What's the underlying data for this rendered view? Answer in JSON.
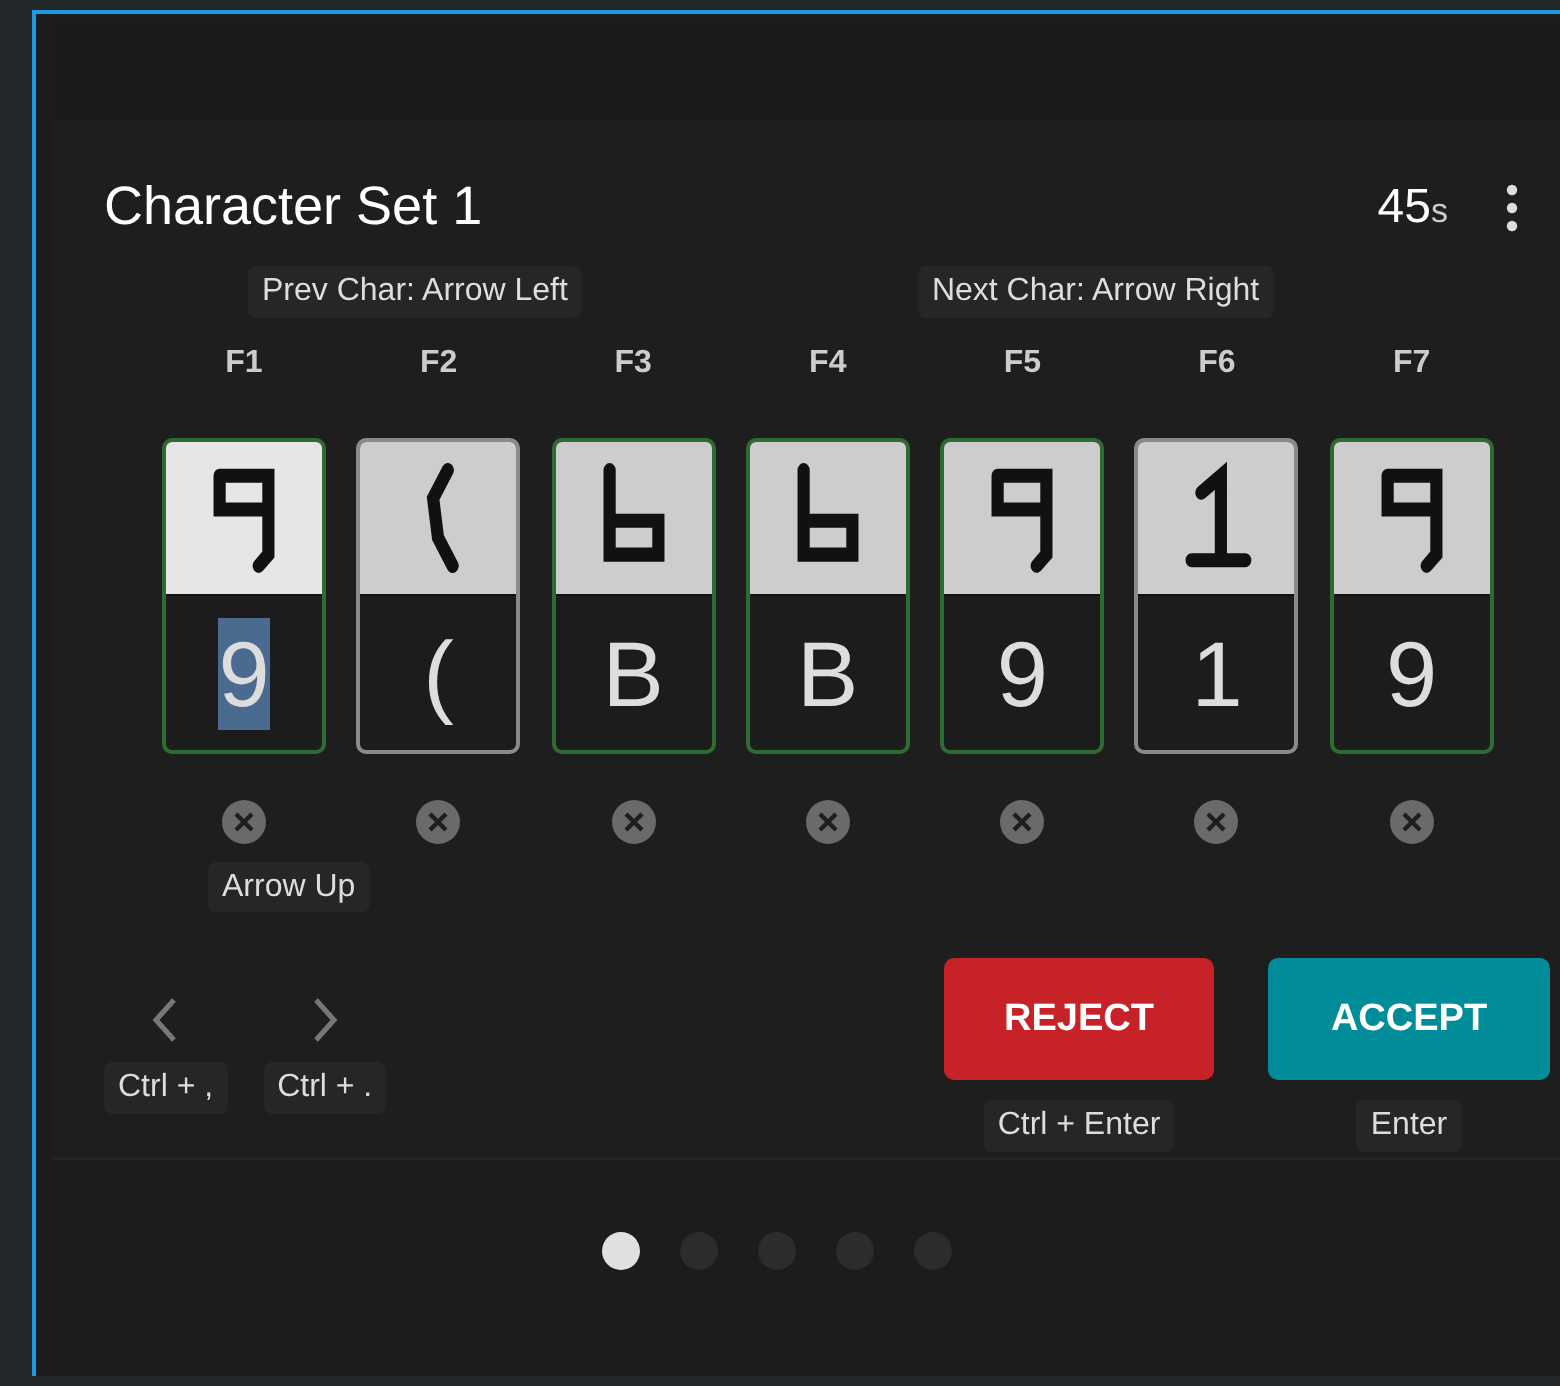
{
  "card": {
    "title": "Character Set 1",
    "timer": {
      "value": "45",
      "unit": "s"
    },
    "hints": {
      "prev": "Prev Char: Arrow Left",
      "next": "Next Char: Arrow Right",
      "up": "Arrow Up"
    },
    "characters": [
      {
        "key": "F1",
        "value": "9",
        "kind": "nine",
        "confirmed": true,
        "selected": true
      },
      {
        "key": "F2",
        "value": "(",
        "kind": "paren",
        "confirmed": false,
        "selected": false
      },
      {
        "key": "F3",
        "value": "B",
        "kind": "b",
        "confirmed": true,
        "selected": false
      },
      {
        "key": "F4",
        "value": "B",
        "kind": "b",
        "confirmed": true,
        "selected": false
      },
      {
        "key": "F5",
        "value": "9",
        "kind": "nine",
        "confirmed": true,
        "selected": false
      },
      {
        "key": "F6",
        "value": "1",
        "kind": "one",
        "confirmed": false,
        "selected": false
      },
      {
        "key": "F7",
        "value": "9",
        "kind": "nine",
        "confirmed": true,
        "selected": false
      }
    ],
    "nav": [
      {
        "kind": "prev",
        "shortcut": "Ctrl + ,"
      },
      {
        "kind": "next",
        "shortcut": "Ctrl + ."
      }
    ],
    "actions": [
      {
        "kind": "reject",
        "label": "REJECT",
        "shortcut": "Ctrl + Enter"
      },
      {
        "kind": "accept",
        "label": "ACCEPT",
        "shortcut": "Enter"
      }
    ]
  },
  "pager": [
    {
      "selected": true
    },
    {
      "selected": false
    },
    {
      "selected": false
    },
    {
      "selected": false
    },
    {
      "selected": false
    }
  ]
}
